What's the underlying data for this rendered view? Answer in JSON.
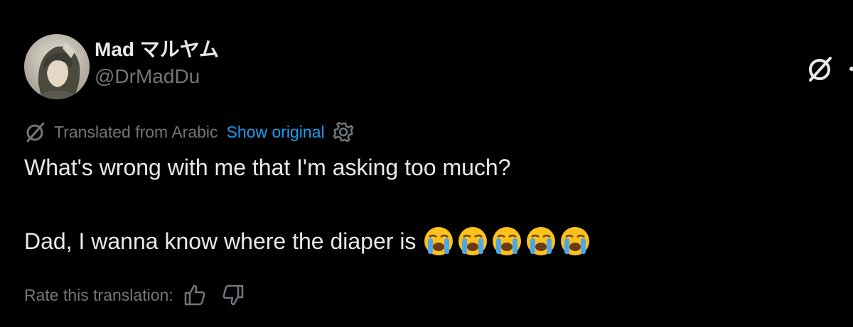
{
  "tweet": {
    "author_name": "Mad マルヤム",
    "author_handle": "@DrMadDu",
    "translation": {
      "notice": "Translated from Arabic",
      "show_original_label": "Show original"
    },
    "text_line1": "What's wrong with me that I'm asking too much?",
    "text_line2": "Dad, I wanna know where the diaper is",
    "emoji": "loudly-crying-face",
    "emoji_count": 5,
    "rate_label": "Rate this translation:"
  },
  "icons": {
    "grok": "grok-icon",
    "more": "more-icon",
    "translate": "translate-icon",
    "settings": "gear-icon",
    "thumbs_up": "thumbs-up-icon",
    "thumbs_down": "thumbs-down-icon"
  },
  "colors": {
    "background": "#000000",
    "text_primary": "#e7e9ea",
    "text_secondary": "#71767b",
    "link": "#1d9bf0"
  }
}
